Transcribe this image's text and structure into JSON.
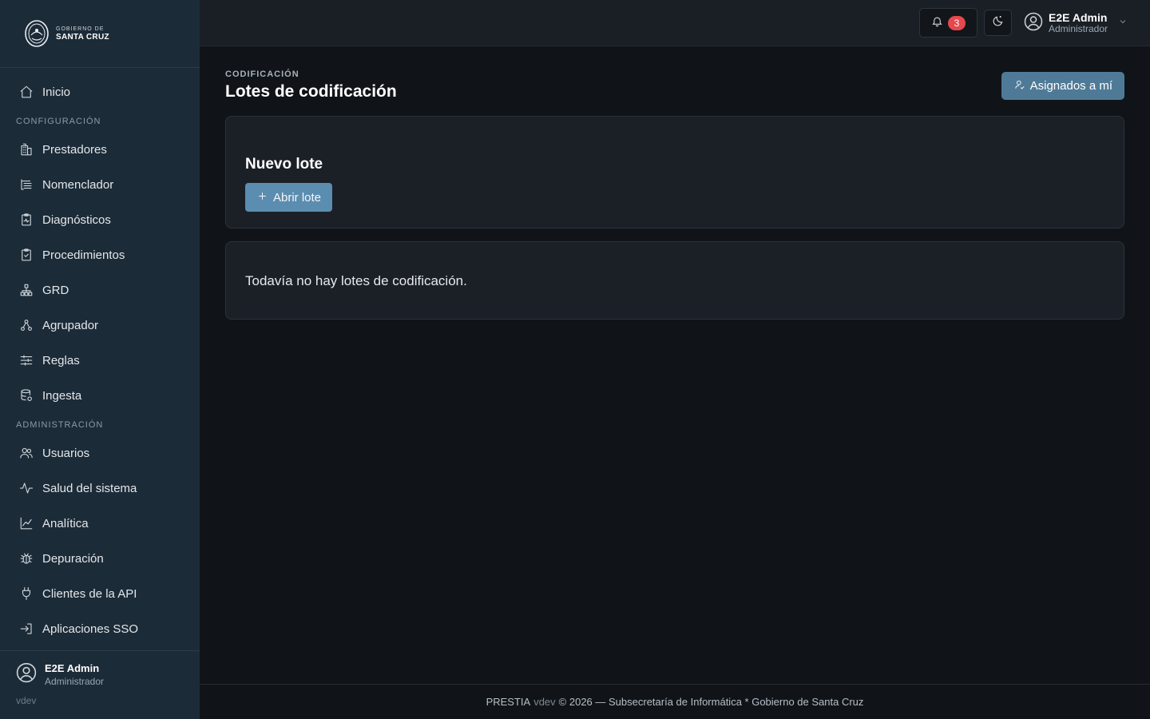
{
  "brand": {
    "line1": "GOBIERNO DE",
    "line2": "SANTA CRUZ"
  },
  "sidebar": {
    "home": {
      "label": "Inicio",
      "icon": "home-icon"
    },
    "sections": [
      {
        "label": "CONFIGURACIÓN",
        "items": [
          {
            "label": "Prestadores",
            "icon": "building-icon"
          },
          {
            "label": "Nomenclador",
            "icon": "list-icon"
          },
          {
            "label": "Diagnósticos",
            "icon": "clipboard-pulse-icon"
          },
          {
            "label": "Procedimientos",
            "icon": "clipboard-check-icon"
          },
          {
            "label": "GRD",
            "icon": "hierarchy-icon"
          },
          {
            "label": "Agrupador",
            "icon": "nodes-icon"
          },
          {
            "label": "Reglas",
            "icon": "sliders-icon"
          },
          {
            "label": "Ingesta",
            "icon": "database-icon"
          }
        ]
      },
      {
        "label": "ADMINISTRACIÓN",
        "items": [
          {
            "label": "Usuarios",
            "icon": "users-icon"
          },
          {
            "label": "Salud del sistema",
            "icon": "activity-icon"
          },
          {
            "label": "Analítica",
            "icon": "chart-line-icon"
          },
          {
            "label": "Depuración",
            "icon": "bug-icon"
          },
          {
            "label": "Clientes de la API",
            "icon": "plug-icon"
          },
          {
            "label": "Aplicaciones SSO",
            "icon": "login-icon"
          }
        ]
      }
    ],
    "user": {
      "name": "E2E Admin",
      "role": "Administrador"
    },
    "version": "vdev"
  },
  "topbar": {
    "notifications_count": "3",
    "user": {
      "name": "E2E Admin",
      "role": "Administrador"
    }
  },
  "main": {
    "eyebrow": "CODIFICACIÓN",
    "title": "Lotes de codificación",
    "assigned_button": "Asignados a mí",
    "new_card": {
      "title": "Nuevo lote",
      "open_button": "Abrir lote"
    },
    "empty_message": "Todavía no hay lotes de codificación."
  },
  "footer": {
    "app": "PRESTIA",
    "version": "vdev",
    "text": "© 2026 — Subsecretaría de Informática * Gobierno de Santa Cruz"
  }
}
